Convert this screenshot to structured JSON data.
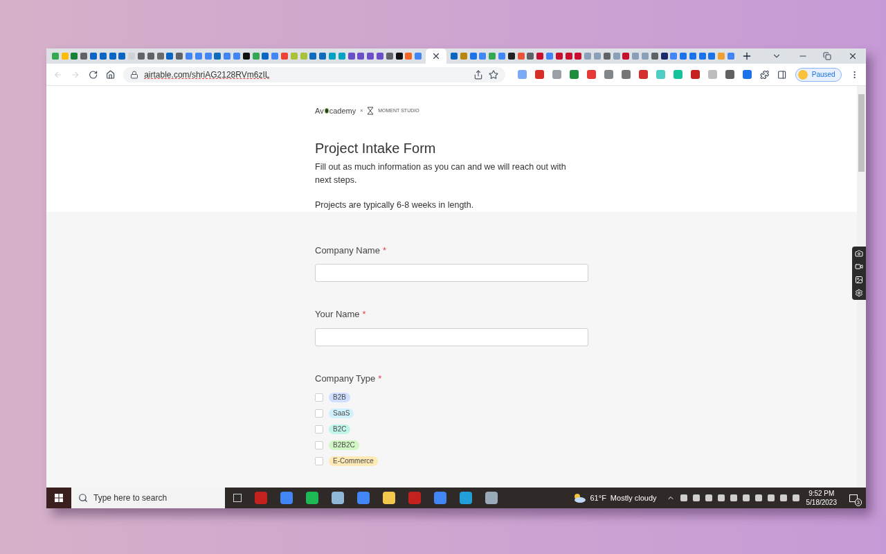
{
  "browser": {
    "tabs": [
      {
        "selected": false
      },
      {
        "selected": false
      },
      {
        "selected": false
      },
      {
        "selected": false
      },
      {
        "selected": false
      },
      {
        "selected": false
      },
      {
        "selected": false
      },
      {
        "selected": false
      },
      {
        "selected": false
      },
      {
        "selected": false
      },
      {
        "selected": false
      },
      {
        "selected": false
      },
      {
        "selected": false
      },
      {
        "selected": false
      },
      {
        "selected": false
      },
      {
        "selected": false
      },
      {
        "selected": false
      },
      {
        "selected": false
      },
      {
        "selected": false
      },
      {
        "selected": false
      },
      {
        "selected": false
      },
      {
        "selected": false
      },
      {
        "selected": false
      },
      {
        "selected": false
      },
      {
        "selected": false
      },
      {
        "selected": false
      },
      {
        "selected": false
      },
      {
        "selected": false
      },
      {
        "selected": false
      },
      {
        "selected": false
      },
      {
        "selected": false
      },
      {
        "selected": false
      },
      {
        "selected": false
      },
      {
        "selected": false
      },
      {
        "selected": false
      },
      {
        "selected": false
      },
      {
        "selected": false
      },
      {
        "selected": false
      },
      {
        "selected": false
      },
      {
        "selected": true
      },
      {
        "selected": false
      },
      {
        "selected": false
      },
      {
        "selected": false
      },
      {
        "selected": false
      },
      {
        "selected": false
      },
      {
        "selected": false
      },
      {
        "selected": false
      },
      {
        "selected": false
      },
      {
        "selected": false
      },
      {
        "selected": false
      },
      {
        "selected": false
      },
      {
        "selected": false
      },
      {
        "selected": false
      },
      {
        "selected": false
      },
      {
        "selected": false
      },
      {
        "selected": false
      },
      {
        "selected": false
      },
      {
        "selected": false
      },
      {
        "selected": false
      },
      {
        "selected": false
      },
      {
        "selected": false
      },
      {
        "selected": false
      },
      {
        "selected": false
      },
      {
        "selected": false
      },
      {
        "selected": false
      },
      {
        "selected": false
      },
      {
        "selected": false
      },
      {
        "selected": false
      },
      {
        "selected": false
      },
      {
        "selected": false
      }
    ],
    "url": "airtable.com/shriAG2128RVm6zIL",
    "profile": "Paused"
  },
  "page": {
    "logo": {
      "start": "Av",
      "end": "cademy"
    },
    "separator": "×",
    "partner": "MOMENT STUDIO",
    "title": "Project Intake Form",
    "paragraphs": [
      "Fill out as much information as you can and we will reach out with next steps.",
      "Projects are typically 6-8 weeks in length."
    ],
    "fields": [
      {
        "kind": "text",
        "label": "Company Name",
        "required_mark": "*"
      },
      {
        "kind": "text",
        "label": "Your Name",
        "required_mark": "*"
      },
      {
        "kind": "checkboxes",
        "label": "Company Type",
        "required_mark": "*",
        "options": [
          {
            "label": "B2B",
            "checked": false,
            "color": "#cfdfff"
          },
          {
            "label": "SaaS",
            "checked": false,
            "color": "#d0f0fd"
          },
          {
            "label": "B2C",
            "checked": false,
            "color": "#c2f5e9"
          },
          {
            "label": "B2B2C",
            "checked": false,
            "color": "#d1f7c4"
          },
          {
            "label": "E-Commerce",
            "checked": false,
            "color": "#ffeab6"
          }
        ]
      }
    ]
  },
  "taskbar": {
    "search_placeholder": "Type here to search",
    "temperature": "61°F",
    "weather": "Mostly cloudy",
    "time": "9:52 PM",
    "date": "5/18/2023",
    "notifications": "3"
  }
}
